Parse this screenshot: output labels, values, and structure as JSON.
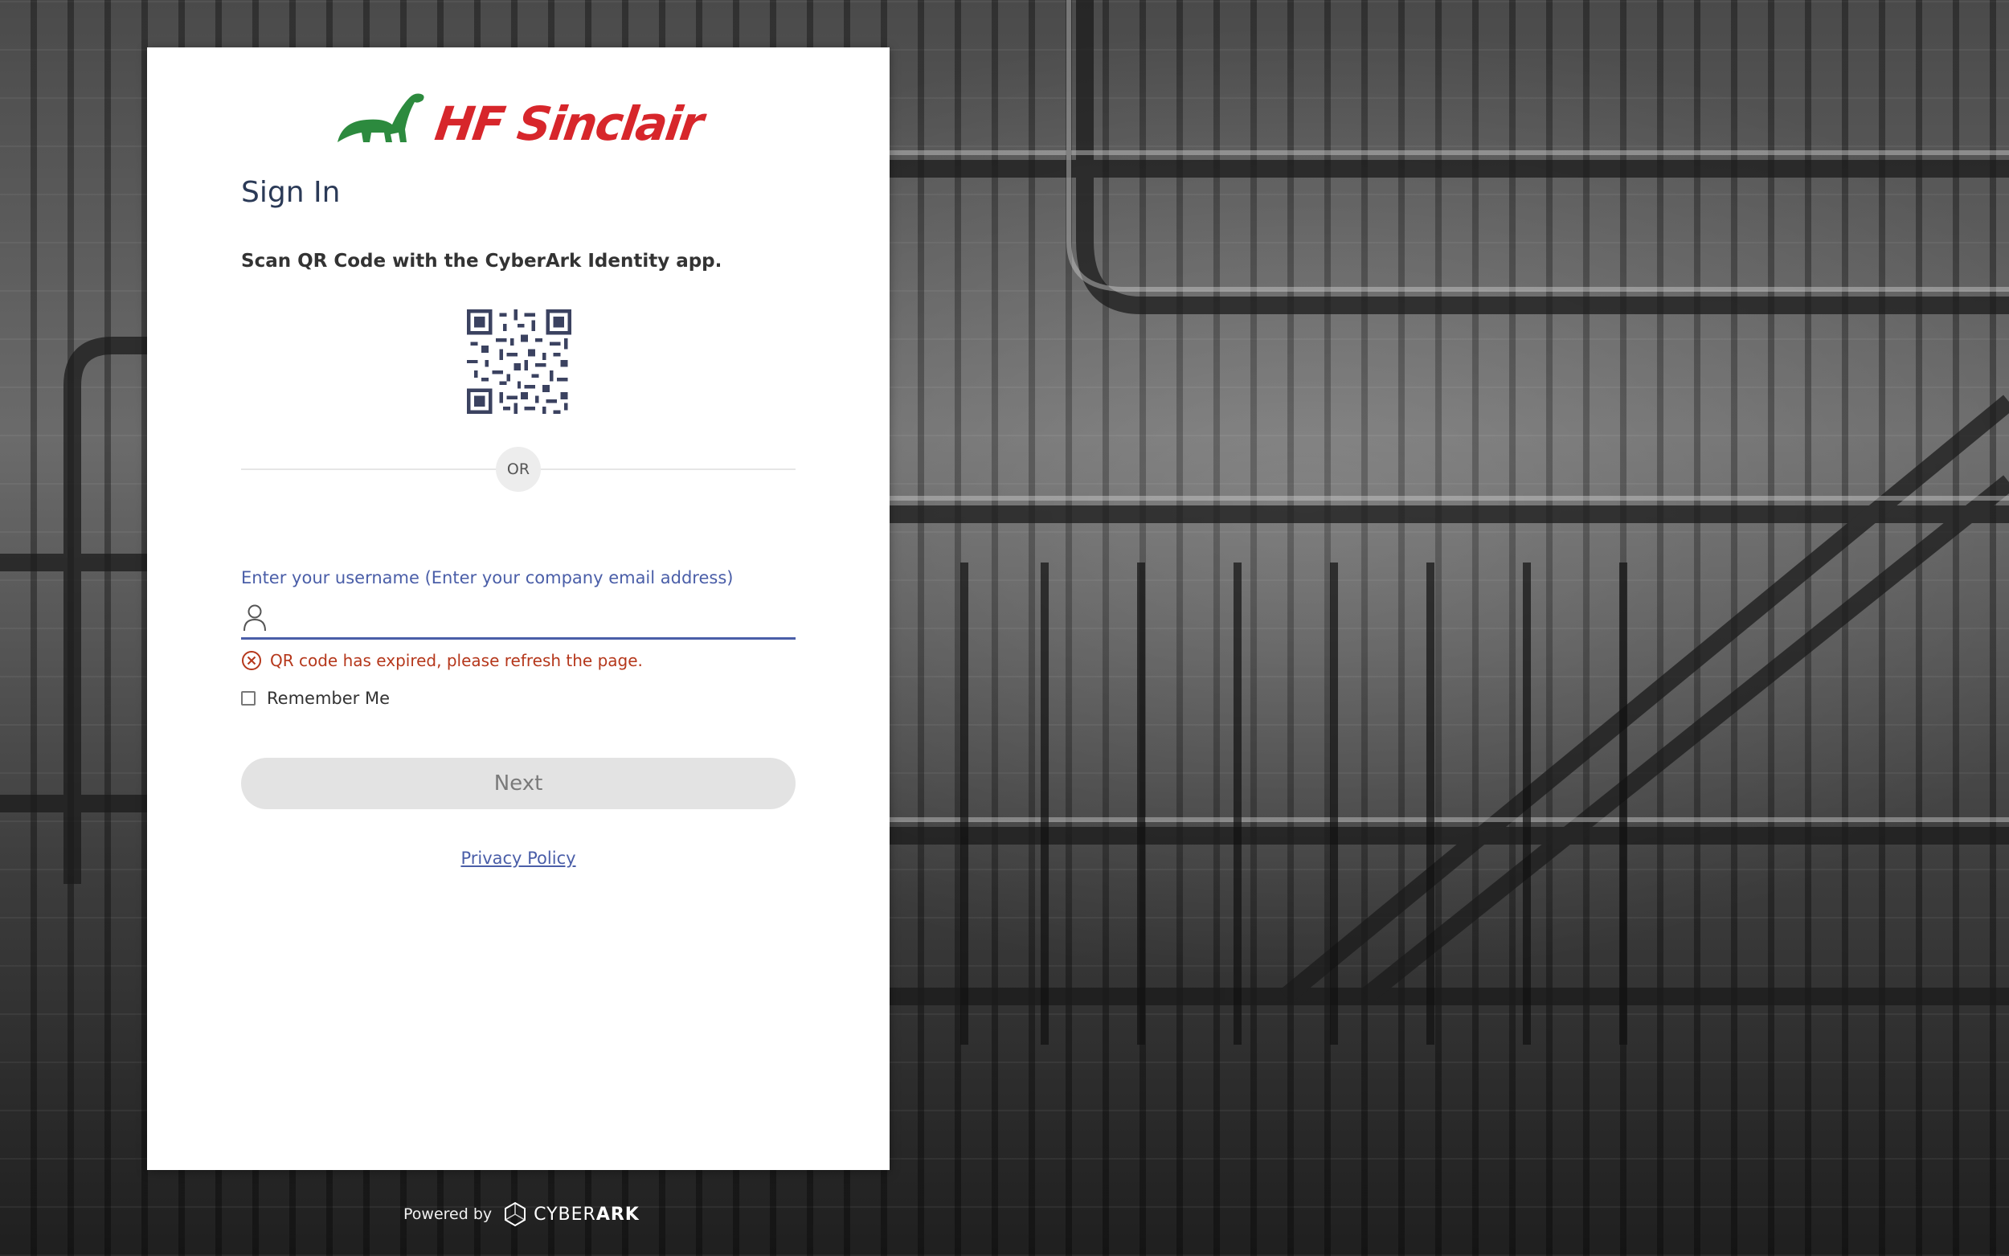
{
  "brand": {
    "logo_text": "HF Sinclair",
    "logo_color": "#d7262b",
    "dino_color": "#2c8a3e"
  },
  "signin": {
    "title": "Sign In",
    "qr_instruction": "Scan QR Code with the CyberArk Identity app.",
    "or_text": "OR",
    "username_label": "Enter your username (Enter your company email address)",
    "username_value": "",
    "error_message": "QR code has expired, please refresh the page.",
    "remember_label": "Remember Me",
    "remember_checked": false,
    "next_label": "Next",
    "privacy_label": "Privacy Policy"
  },
  "footer": {
    "powered_by": "Powered by",
    "vendor_prefix": "CYBER",
    "vendor_suffix": "ARK"
  },
  "colors": {
    "accent": "#4a5ea8",
    "title": "#2b3a57",
    "error": "#b5371b",
    "button_disabled_bg": "#e3e3e3"
  },
  "icons": [
    "user-icon",
    "error-circle-icon",
    "qr-code-icon",
    "cyberark-cube-icon",
    "dinosaur-icon"
  ]
}
